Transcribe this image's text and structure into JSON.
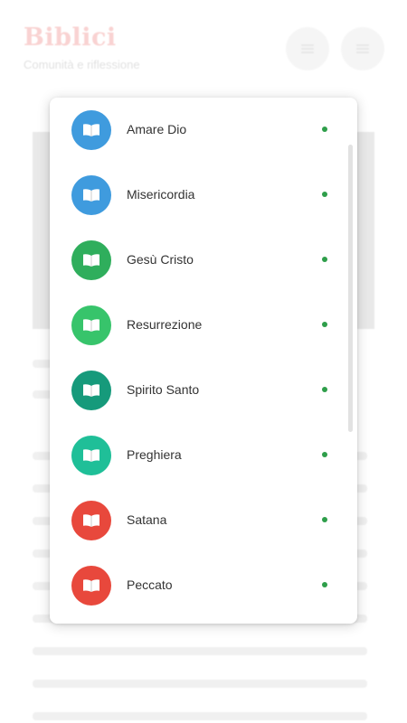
{
  "header": {
    "logo": "Biblici",
    "tagline": "Comunità e riflessione"
  },
  "topics": [
    {
      "label": "Amare Dio",
      "color": "#3f9bde",
      "icon": "book-icon",
      "indicator": "green-dot"
    },
    {
      "label": "Misericordia",
      "color": "#3f9bde",
      "icon": "book-icon",
      "indicator": "green-dot"
    },
    {
      "label": "Gesù Cristo",
      "color": "#2fae5c",
      "icon": "book-icon",
      "indicator": "green-dot"
    },
    {
      "label": "Resurrezione",
      "color": "#37c46b",
      "icon": "book-icon",
      "indicator": "green-dot"
    },
    {
      "label": "Spirito Santo",
      "color": "#169a7b",
      "icon": "book-icon",
      "indicator": "green-dot"
    },
    {
      "label": "Preghiera",
      "color": "#1fbf98",
      "icon": "book-icon",
      "indicator": "green-dot"
    },
    {
      "label": "Satana",
      "color": "#e8483c",
      "icon": "book-icon",
      "indicator": "green-dot"
    },
    {
      "label": "Peccato",
      "color": "#e8483c",
      "icon": "book-icon",
      "indicator": "green-dot"
    }
  ],
  "colors": {
    "indicator": "#2e9e4a",
    "logo": "#e53935"
  }
}
